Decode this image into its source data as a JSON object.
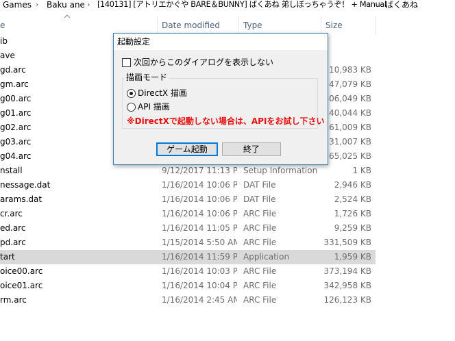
{
  "breadcrumb": {
    "items": [
      "Games",
      "Baku ane",
      "[140131] [アトリエかぐや BARE＆BUNNY] ばくあね 弟しぼっちゃうぞ！ + Manual",
      "ばくあね"
    ],
    "separator": "›"
  },
  "columns": {
    "name": "e",
    "date": "Date modified",
    "type": "Type",
    "size": "Size"
  },
  "files": [
    {
      "name": "ib",
      "date": "",
      "type": "",
      "size": ""
    },
    {
      "name": "ave",
      "date": "",
      "type": "",
      "size": ""
    },
    {
      "name": "gd.arc",
      "date": "",
      "type": "",
      "size": "210,983 KB"
    },
    {
      "name": "gm.arc",
      "date": "",
      "type": "",
      "size": "47,079 KB"
    },
    {
      "name": "g00.arc",
      "date": "",
      "type": "",
      "size": "406,049 KB"
    },
    {
      "name": "g01.arc",
      "date": "",
      "type": "",
      "size": "340,044 KB"
    },
    {
      "name": "g02.arc",
      "date": "",
      "type": "",
      "size": "361,009 KB"
    },
    {
      "name": "g03.arc",
      "date": "",
      "type": "",
      "size": "331,007 KB"
    },
    {
      "name": "g04.arc",
      "date": "",
      "type": "",
      "size": "365,025 KB"
    },
    {
      "name": "nstall",
      "date": "9/12/2017 11:13 PM",
      "type": "Setup Information",
      "size": "1 KB"
    },
    {
      "name": "nessage.dat",
      "date": "1/16/2014 10:06 PM",
      "type": "DAT File",
      "size": "2,946 KB"
    },
    {
      "name": "arams.dat",
      "date": "1/16/2014 10:06 PM",
      "type": "DAT File",
      "size": "2,524 KB"
    },
    {
      "name": "cr.arc",
      "date": "1/16/2014 10:06 PM",
      "type": "ARC File",
      "size": "1,726 KB"
    },
    {
      "name": "ed.arc",
      "date": "1/16/2014 11:05 PM",
      "type": "ARC File",
      "size": "9,259 KB"
    },
    {
      "name": "pd.arc",
      "date": "1/15/2014 5:50 AM",
      "type": "ARC File",
      "size": "331,509 KB"
    },
    {
      "name": "tart",
      "date": "1/16/2014 11:59 PM",
      "type": "Application",
      "size": "1,959 KB"
    },
    {
      "name": "oice00.arc",
      "date": "1/16/2014 10:03 PM",
      "type": "ARC File",
      "size": "373,194 KB"
    },
    {
      "name": "oice01.arc",
      "date": "1/16/2014 10:04 PM",
      "type": "ARC File",
      "size": "342,958 KB"
    },
    {
      "name": "rm.arc",
      "date": "1/16/2014 2:45 AM",
      "type": "ARC File",
      "size": "126,123 KB"
    }
  ],
  "selected_row": "tart",
  "dialog": {
    "title": "起動設定",
    "checkbox_label": "次回からこのダイアログを表示しない",
    "checkbox_checked": false,
    "group_title": "描画モード",
    "radio_directx": "DirectX 描画",
    "radio_api": "API 描画",
    "selected_mode": "DirectX 描画",
    "warning": "※DirectXで起動しない場合は、APIをお試し下さい",
    "start_button": "ゲーム起動",
    "exit_button": "終了"
  },
  "colors": {
    "dialog_border": "#3c7fb1",
    "warning": "#e81010",
    "default_button_border": "#0078d7",
    "selected_row": "#d9d9d9",
    "header_text": "#4c607a"
  }
}
